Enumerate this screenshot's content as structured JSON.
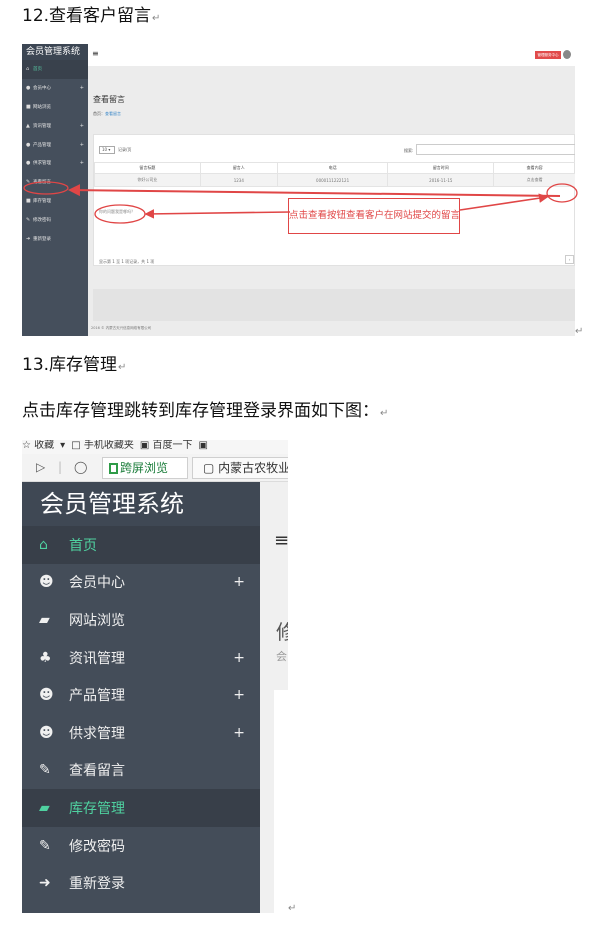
{
  "headings": {
    "h12": "12.查看客户留言",
    "h13": "13.库存管理",
    "desc": "点击库存管理跳转到库存管理登录界面如下图："
  },
  "para_mark": "↵",
  "shot1": {
    "brand": "会员管理系统",
    "nav": [
      {
        "icon": "home-icon",
        "glyph": "⌂",
        "label": "首页",
        "plus": false,
        "active": true
      },
      {
        "icon": "users-icon",
        "glyph": "●",
        "label": "会员中心",
        "plus": true
      },
      {
        "icon": "truck-icon",
        "glyph": "■",
        "label": "网站浏览",
        "plus": false
      },
      {
        "icon": "sitemap-icon",
        "glyph": "▲",
        "label": "资讯管理",
        "plus": true
      },
      {
        "icon": "users-icon",
        "glyph": "●",
        "label": "产品管理",
        "plus": true
      },
      {
        "icon": "users-icon",
        "glyph": "●",
        "label": "供求管理",
        "plus": true
      },
      {
        "icon": "wrench-icon",
        "glyph": "✎",
        "label": "查看留言",
        "plus": false
      },
      {
        "icon": "truck-icon",
        "glyph": "■",
        "label": "库存管理",
        "plus": false
      },
      {
        "icon": "wrench-icon",
        "glyph": "✎",
        "label": "修改密码",
        "plus": false
      },
      {
        "icon": "sign-out-icon",
        "glyph": "➜",
        "label": "重新登录",
        "plus": false
      }
    ],
    "plus": "+",
    "top_button": "管理服务中心",
    "page_title": "查看留言",
    "breadcrumb_home": "首页：",
    "breadcrumb_current": "查看留言",
    "page_length": "10",
    "length_suffix": "记录/页",
    "search_label": "搜索:",
    "columns": [
      "留言标题",
      "留言人",
      "电话",
      "留言时间",
      "查看内容"
    ],
    "rows": [
      [
        "你好公司业",
        "1234",
        "0000111222121",
        "2016-11-15",
        "点击查看"
      ]
    ],
    "info": "显示第 1 至 1 项记录，共 1 项",
    "pager_next": "›",
    "footer": "2016 © 内蒙古天兴信息网络有限公司",
    "link_note": "你的问题我是哪吗？",
    "callout": "点击查看按钮查看客户在网站提交的留言",
    "hamburger": "≡"
  },
  "shot2": {
    "toolbar": [
      "☆ 收藏",
      "▾",
      "□ 手机收藏夹",
      "▣ 百度一下",
      "▣"
    ],
    "nav_icons": [
      "▷",
      "|",
      "◯"
    ],
    "tab1": "跨屏浏览",
    "tab2": "内蒙古农牧业",
    "brand": "会员管理系统",
    "hamburger": "≡",
    "main_big": "修",
    "main_small": "会",
    "nav": [
      {
        "icon": "home-icon",
        "glyph": "⌂",
        "label": "首页",
        "plus": false,
        "state": "green-dark"
      },
      {
        "icon": "users-icon",
        "glyph": "☻",
        "label": "会员中心",
        "plus": true
      },
      {
        "icon": "truck-icon",
        "glyph": "▰",
        "label": "网站浏览",
        "plus": false
      },
      {
        "icon": "sitemap-icon",
        "glyph": "♣",
        "label": "资讯管理",
        "plus": true
      },
      {
        "icon": "users-icon",
        "glyph": "☻",
        "label": "产品管理",
        "plus": true
      },
      {
        "icon": "users-icon",
        "glyph": "☻",
        "label": "供求管理",
        "plus": true
      },
      {
        "icon": "wrench-icon",
        "glyph": "✎",
        "label": "查看留言",
        "plus": false
      },
      {
        "icon": "truck-icon",
        "glyph": "▰",
        "label": "库存管理",
        "plus": false,
        "state": "green-dark"
      },
      {
        "icon": "wrench-icon",
        "glyph": "✎",
        "label": "修改密码",
        "plus": false
      },
      {
        "icon": "sign-out-icon",
        "glyph": "➜",
        "label": "重新登录",
        "plus": false
      }
    ],
    "plus": "+"
  },
  "colors": {
    "sidebar": "#444d59",
    "accent_green": "#4fd1a0",
    "annotation_red": "#e04646"
  }
}
